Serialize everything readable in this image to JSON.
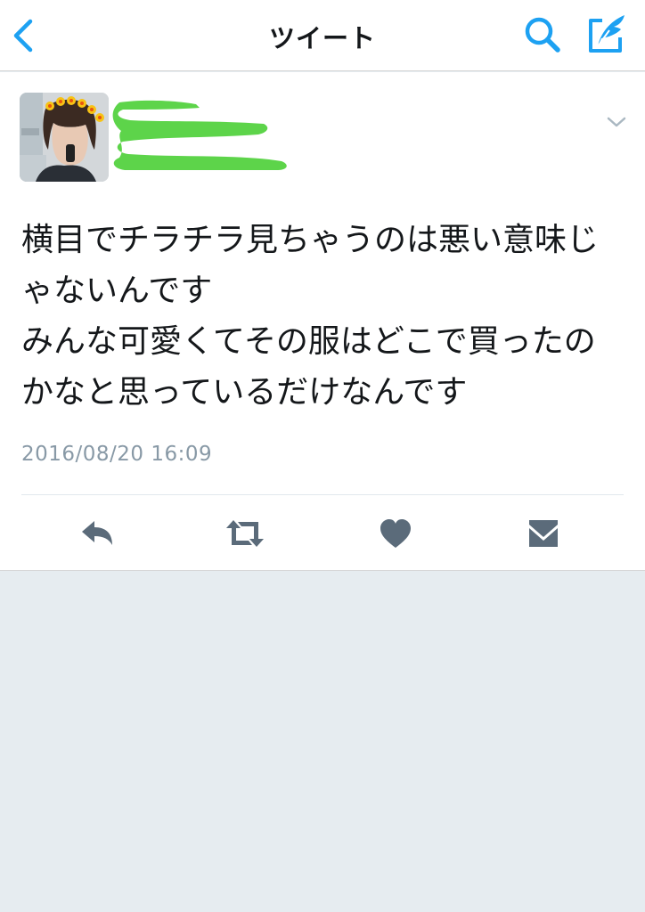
{
  "nav": {
    "title": "ツイート"
  },
  "tweet": {
    "text": "横目でチラチラ見ちゃうのは悪い意味じゃないんです\nみんな可愛くてその服はどこで買ったのかなと思っているだけなんです",
    "timestamp": "2016/08/20 16:09"
  },
  "icons": {
    "back": "chevron-left-icon",
    "search": "search-icon",
    "compose": "compose-icon",
    "caret": "chevron-down-icon",
    "reply": "reply-icon",
    "retweet": "retweet-icon",
    "like": "heart-icon",
    "dm": "envelope-icon"
  },
  "colors": {
    "accent": "#1da1f2",
    "action_icon": "#5b6b7a",
    "timestamp": "#8899a6",
    "background": "#e6ecf0",
    "redaction": "#5dd44a"
  }
}
